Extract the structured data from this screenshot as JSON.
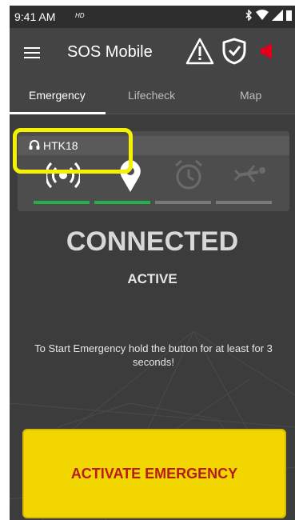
{
  "status_bar": {
    "time": "9:41 AM",
    "hd_label": "HD",
    "icons": [
      "bluetooth-icon",
      "wifi-icon",
      "signal-icon",
      "battery-icon"
    ]
  },
  "app_bar": {
    "title": "SOS Mobile",
    "icons": [
      "menu-icon",
      "warning-icon",
      "shield-check-icon",
      "speaker-icon"
    ]
  },
  "tabs": [
    {
      "label": "Emergency",
      "active": true
    },
    {
      "label": "Lifecheck",
      "active": false
    },
    {
      "label": "Map",
      "active": false
    }
  ],
  "device": {
    "name": "HTK18",
    "indicators": [
      {
        "icon": "radio-signal-icon",
        "status_color": "#22b14c"
      },
      {
        "icon": "location-pin-icon",
        "status_color": "#22b14c"
      },
      {
        "icon": "alarm-clock-icon",
        "status_color": "#7a7a7a"
      },
      {
        "icon": "man-down-icon",
        "status_color": "#7a7a7a"
      }
    ]
  },
  "status": {
    "connection": "CONNECTED",
    "state": "ACTIVE"
  },
  "instruction": "To Start Emergency hold the button for at least for 3 seconds!",
  "emergency_button": {
    "label": "ACTIVATE EMERGENCY"
  },
  "colors": {
    "highlight": "#f4f200",
    "button_bg": "#f2d600",
    "button_text": "#b71c1c",
    "indicator_ok": "#22b14c",
    "speaker_red": "#e0001b"
  }
}
